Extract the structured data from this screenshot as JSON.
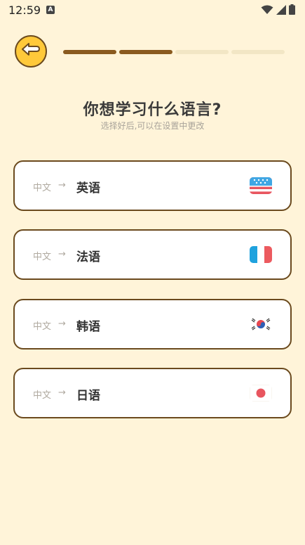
{
  "status_bar": {
    "time": "12:59",
    "notification_icon_letter": "A"
  },
  "progress": {
    "total_steps": 4,
    "completed_steps": 2
  },
  "header": {
    "title": "你想学习什么语言?",
    "subtitle": "选择好后,可以在设置中更改"
  },
  "languages": [
    {
      "source": "中文",
      "arrow": "→",
      "target": "英语",
      "flag_icon": "us-flag-icon"
    },
    {
      "source": "中文",
      "arrow": "→",
      "target": "法语",
      "flag_icon": "france-flag-icon"
    },
    {
      "source": "中文",
      "arrow": "→",
      "target": "韩语",
      "flag_icon": "korea-flag-icon"
    },
    {
      "source": "中文",
      "arrow": "→",
      "target": "日语",
      "flag_icon": "japan-flag-icon"
    }
  ],
  "colors": {
    "background": "#fff4d9",
    "accent": "#ffc93a",
    "border": "#6b4a1e",
    "progress_done": "#8a5a1f",
    "progress_todo": "#f2e6c5"
  }
}
